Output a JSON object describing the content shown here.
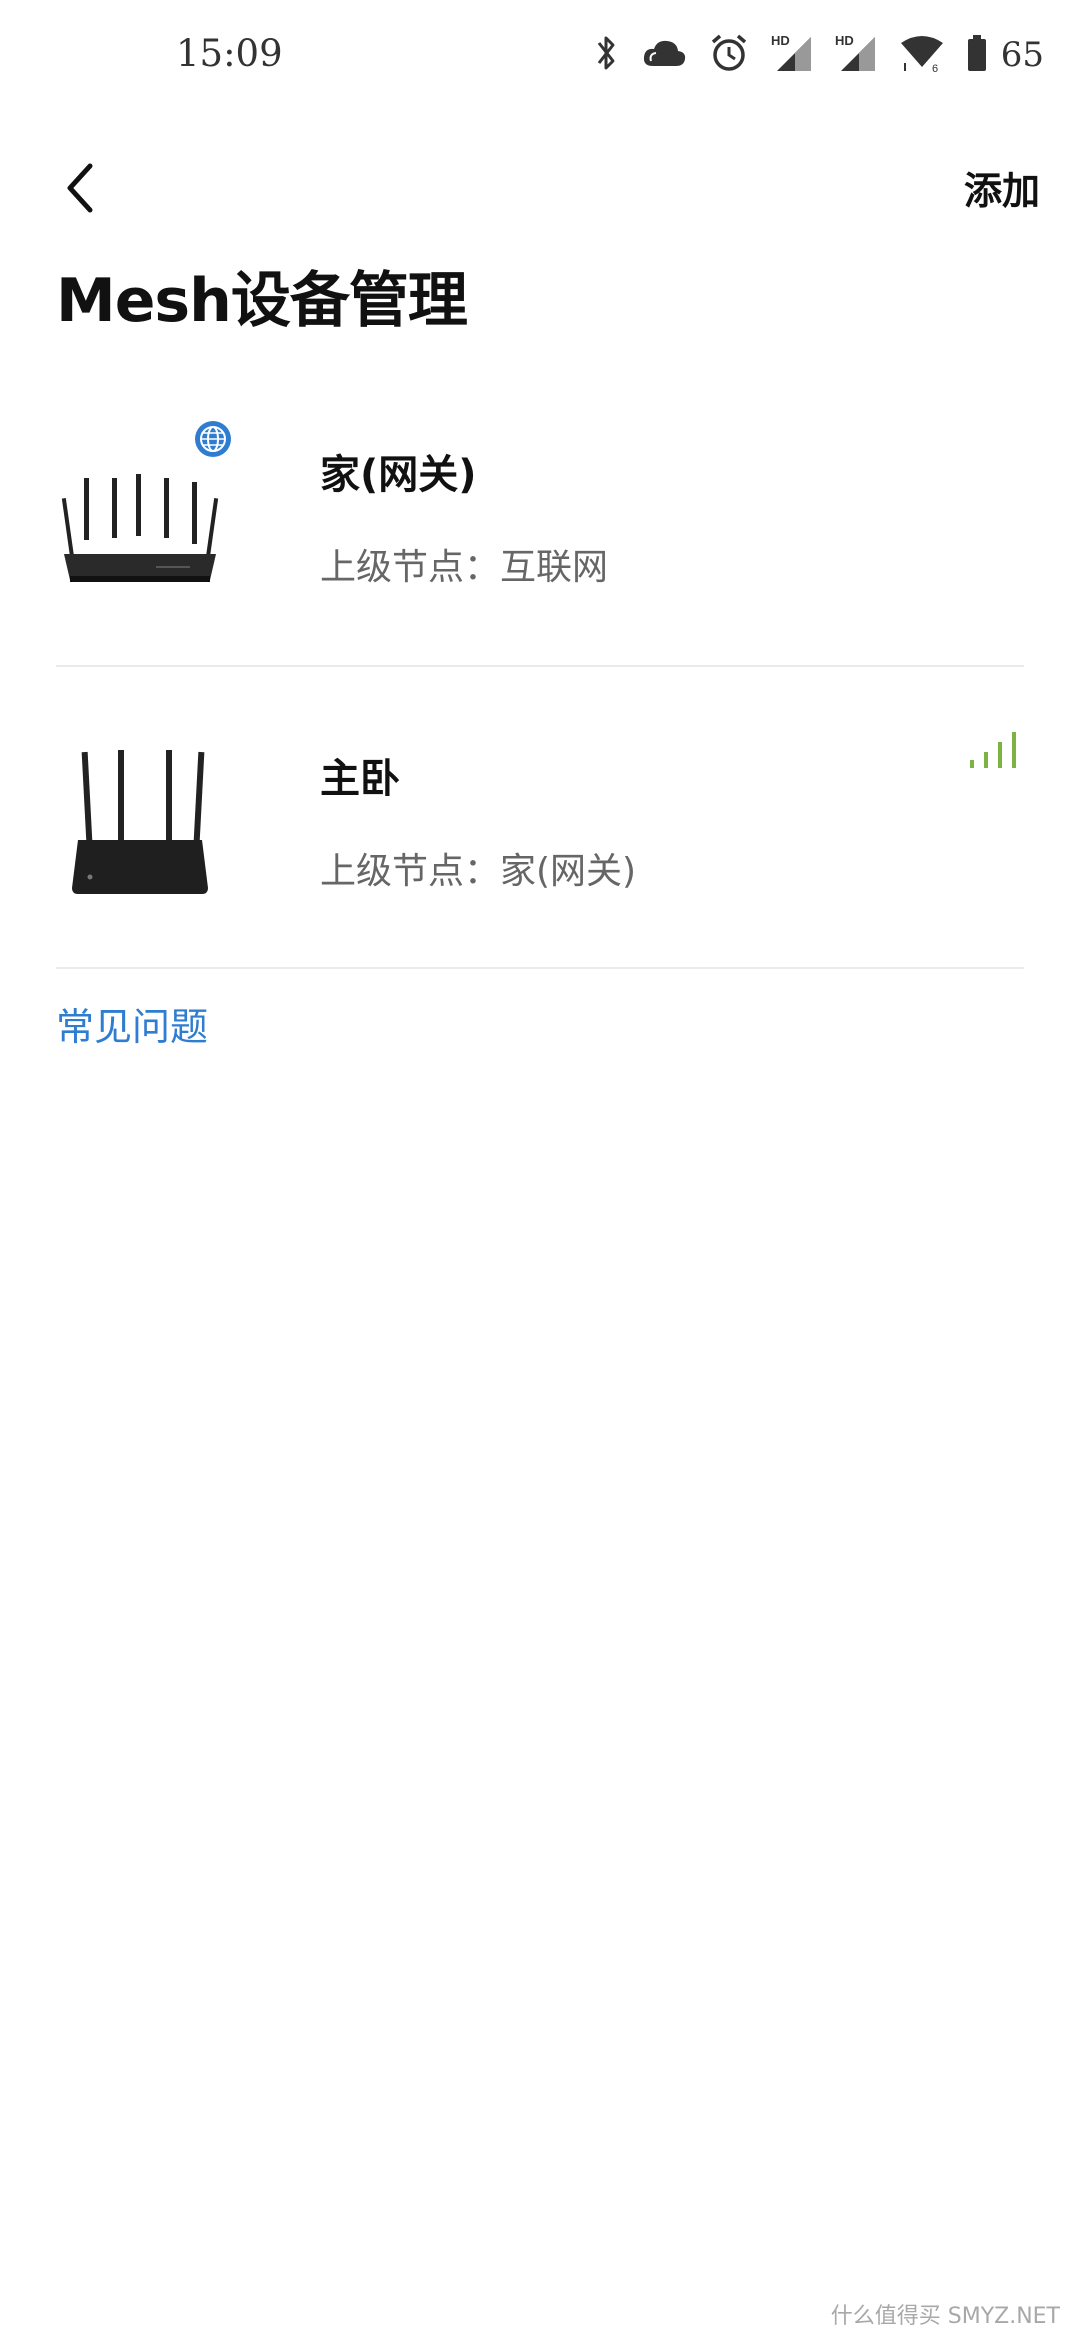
{
  "status_bar": {
    "time": "15:09",
    "battery_percent": "65",
    "icons": [
      "bluetooth-icon",
      "cloud-icon",
      "alarm-icon",
      "hd-signal-icon",
      "hd-signal-icon",
      "wifi-icon",
      "battery-icon"
    ],
    "hd_label": "HD",
    "wifi_badge": "6"
  },
  "header": {
    "back_icon": "chevron-left-icon",
    "add_label": "添加",
    "title": "Mesh设备管理"
  },
  "devices": [
    {
      "name": "家(网关)",
      "parent_label": "上级节点：互联网",
      "badge_icon": "globe-icon",
      "image_icon": "router-six-antenna-icon"
    },
    {
      "name": "主卧",
      "parent_label": "上级节点：家(网关)",
      "signal_icon": "signal-strength-icon",
      "image_icon": "router-four-antenna-icon"
    }
  ],
  "faq_label": "常见问题",
  "watermark": "什么值得买 SMYZ.NET",
  "colors": {
    "accent": "#2f7dd1",
    "signal": "#7cb342",
    "badge": "#2f7dd1"
  }
}
